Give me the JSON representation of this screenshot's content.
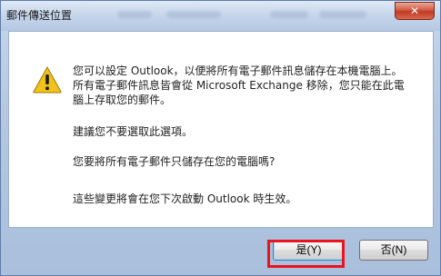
{
  "window": {
    "title": "郵件傳送位置",
    "close_glyph": "✕"
  },
  "message": {
    "paragraph1": "您可以設定 Outlook，以便將所有電子郵件訊息儲存在本機電腦上。所有電子郵件訊息皆會從 Microsoft Exchange 移除，您只能在此電腦上存取您的郵件。",
    "paragraph2": "建議您不要選取此選項。",
    "paragraph3": "您要將所有電子郵件只儲存在您的電腦嗎?",
    "paragraph4": "這些變更將會在您下次啟動 Outlook 時生效。"
  },
  "buttons": {
    "yes_label": "是(Y)",
    "no_label": "否(N)"
  },
  "colors": {
    "highlight": "#e8141e",
    "warning": "#f2c21a"
  },
  "icons": {
    "dialog_icon": "warning-icon",
    "close_icon": "close-icon"
  }
}
